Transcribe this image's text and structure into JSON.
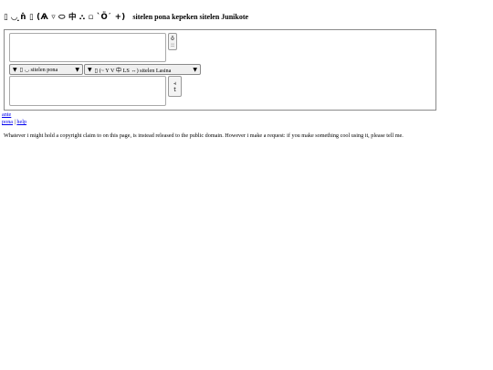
{
  "header": {
    "glyphs": "▯ ◡ ̣n̂ ▯ (Ѧ ▿ ⬭ 中 ⛬ ▫ `Ö᾽ +)",
    "title": "sitelen pona kepeken sitelen Junikote"
  },
  "converter": {
    "input_value": "",
    "output_value": "",
    "swap_button_top": "ô\n::",
    "swap_button_bottom": "ꟶ\nt",
    "source_select": {
      "arrow": "▼",
      "value": "▯ ◡ sitelen pona",
      "dropdown_arrow": "▼"
    },
    "target_select": {
      "arrow": "▼",
      "value": "▯ (~ Y V 中 LS ↔) sitelen Lasina",
      "dropdown_arrow": "▼"
    }
  },
  "nav": {
    "ante_link": "ante",
    "pona_link": "pona",
    "separator": "|",
    "help_link": "help"
  },
  "notice": "Whatever i might hold a copyright claim to on this page, is instead released to the public domain. However i make a request: if you make something cool using it, please tell me."
}
